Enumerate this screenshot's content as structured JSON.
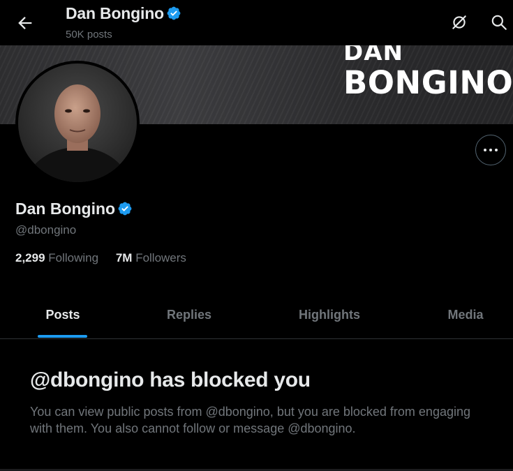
{
  "header": {
    "name": "Dan Bongino",
    "post_count": "50K posts",
    "back_icon": "back-arrow-icon",
    "grok_icon": "grok-icon",
    "search_icon": "search-icon"
  },
  "banner": {
    "line1": "DAN",
    "line2": "BONGINO"
  },
  "profile": {
    "name": "Dan Bongino",
    "handle": "@dbongino",
    "verified_color": "#1d9bf0",
    "following_count": "2,299",
    "following_label": "Following",
    "followers_count": "7M",
    "followers_label": "Followers"
  },
  "tabs": [
    {
      "label": "Posts",
      "active": true
    },
    {
      "label": "Replies",
      "active": false
    },
    {
      "label": "Highlights",
      "active": false
    },
    {
      "label": "Media",
      "active": false
    }
  ],
  "blocked": {
    "title": "@dbongino has blocked you",
    "message": "You can view public posts from @dbongino, but you are blocked from engaging with them. You also cannot follow or message @dbongino."
  },
  "colors": {
    "accent": "#1d9bf0",
    "background": "#000000",
    "text_primary": "#e7e9ea",
    "text_secondary": "#71767b"
  }
}
